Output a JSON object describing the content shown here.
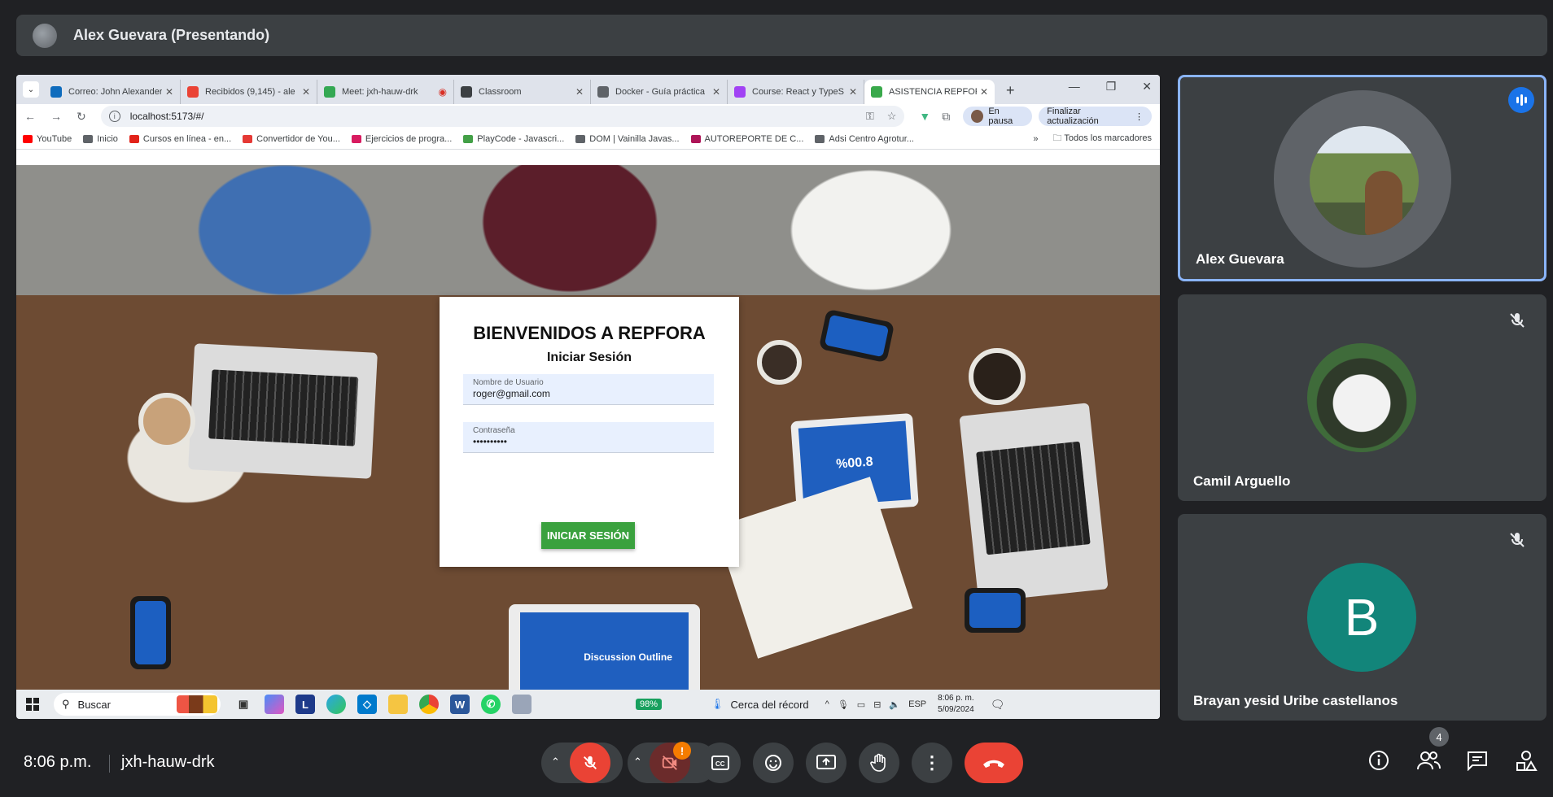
{
  "presenter": {
    "name": "Alex Guevara (Presentando)"
  },
  "browser": {
    "tabs": [
      {
        "label": "Correo: John Alexander",
        "color": "#0f6cbd"
      },
      {
        "label": "Recibidos (9,145) - ale",
        "color": "#ea4335"
      },
      {
        "label": "Meet: jxh-hauw-drk",
        "color": "#34a853"
      },
      {
        "label": "Classroom",
        "color": "#3c4043"
      },
      {
        "label": "Docker - Guía práctica",
        "color": "#5f6368"
      },
      {
        "label": "Course: React y TypeS",
        "color": "#a142f4"
      },
      {
        "label": "ASISTENCIA REPFORA",
        "color": "#39a94b"
      }
    ],
    "url": "localhost:5173/#/",
    "pause_label": "En pausa",
    "update_label": "Finalizar actualización",
    "bookmarks": [
      {
        "label": "YouTube",
        "color": "#ff0000"
      },
      {
        "label": "Inicio",
        "color": "#5f6368"
      },
      {
        "label": "Cursos en línea - en...",
        "color": "#e2231a"
      },
      {
        "label": "Convertidor de You...",
        "color": "#e53935"
      },
      {
        "label": "Ejercicios de progra...",
        "color": "#d81b60"
      },
      {
        "label": "PlayCode - Javascri...",
        "color": "#43a047"
      },
      {
        "label": "DOM | Vainilla Javas...",
        "color": "#5f6368"
      },
      {
        "label": "AUTOREPORTE DE C...",
        "color": "#ad1457"
      },
      {
        "label": "Adsi Centro Agrotur...",
        "color": "#5f6368"
      }
    ],
    "all_bookmarks": "Todos los marcadores"
  },
  "login": {
    "title": "BIENVENIDOS A REPFORA",
    "subtitle": "Iniciar Sesión",
    "username_label": "Nombre de Usuario",
    "username_value": "roger@gmail.com",
    "password_label": "Contraseña",
    "password_value": "••••••••••",
    "button_label": "INICIAR SESIÓN"
  },
  "photo": {
    "tablet_text": "%00.8",
    "bottom_tablet_text": "Discussion Outline"
  },
  "taskbar": {
    "search_label": "Buscar",
    "battery": "98%",
    "weather": "Cerca del récord",
    "lang": "ESP",
    "time": "8:06 p. m.",
    "date": "5/09/2024",
    "icon_l_letter": "L"
  },
  "participants": [
    {
      "name": "Alex Guevara",
      "speaking": true
    },
    {
      "name": "Camil Arguello",
      "muted": true
    },
    {
      "name": "Brayan yesid Uribe castellanos",
      "muted": true,
      "initial": "B",
      "color": "#12857a"
    }
  ],
  "meeting": {
    "time": "8:06 p.m.",
    "code": "jxh-hauw-drk",
    "people_count": "4",
    "camera_alert": "!"
  }
}
